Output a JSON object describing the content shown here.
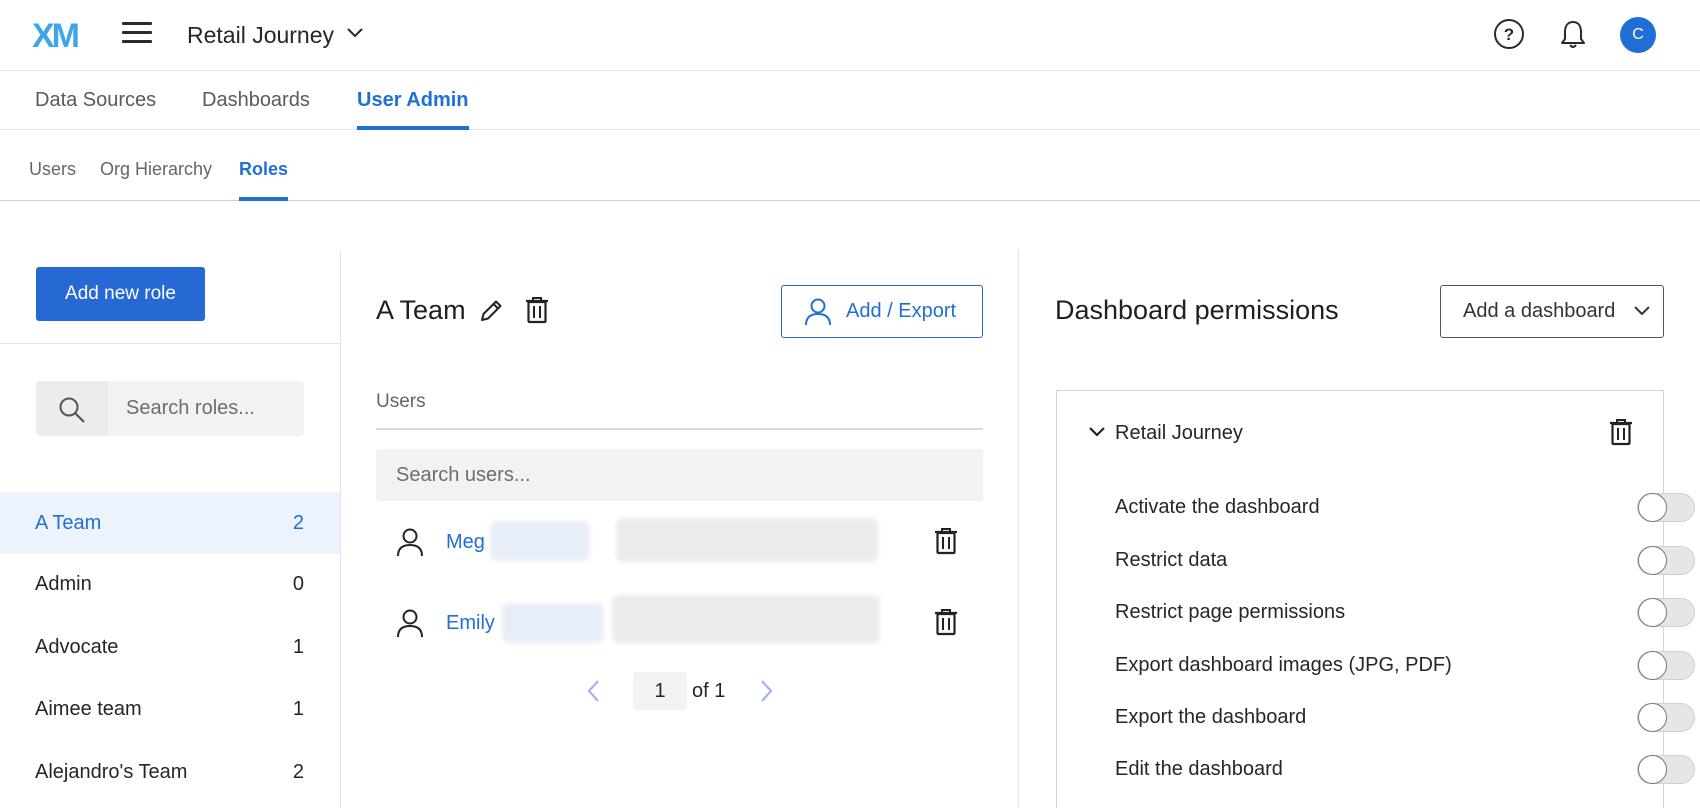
{
  "app": {
    "logo_text": "XM",
    "project_name": "Retail Journey",
    "avatar_initial": "C",
    "icons": [
      "hamburger-icon",
      "chevron-down-icon",
      "help-icon",
      "bell-icon"
    ]
  },
  "primary_tabs": [
    {
      "label": "Data Sources",
      "active": false
    },
    {
      "label": "Dashboards",
      "active": false
    },
    {
      "label": "User Admin",
      "active": true
    }
  ],
  "secondary_tabs": [
    {
      "label": "Users",
      "active": false
    },
    {
      "label": "Org Hierarchy",
      "active": false
    },
    {
      "label": "Roles",
      "active": true
    }
  ],
  "roles_panel": {
    "add_button_label": "Add new role",
    "search_placeholder": "Search roles...",
    "roles": [
      {
        "name": "A Team",
        "count": "2",
        "selected": true
      },
      {
        "name": "Admin",
        "count": "0",
        "selected": false
      },
      {
        "name": "Advocate",
        "count": "1",
        "selected": false
      },
      {
        "name": "Aimee team",
        "count": "1",
        "selected": false
      },
      {
        "name": "Alejandro's Team",
        "count": "2",
        "selected": false
      }
    ]
  },
  "role_detail": {
    "title": "A Team",
    "add_export_label": "Add / Export",
    "users_label": "Users",
    "search_placeholder": "Search users...",
    "users": [
      {
        "name": "Meg"
      },
      {
        "name": "Emily"
      }
    ],
    "pagination": {
      "current_page": "1",
      "of_label": "of 1"
    }
  },
  "dashboard_permissions": {
    "title": "Dashboard permissions",
    "add_dashboard_label": "Add a dashboard",
    "dashboard_name": "Retail Journey",
    "permissions": [
      {
        "label": "Activate the dashboard",
        "enabled": false
      },
      {
        "label": "Restrict data",
        "enabled": false
      },
      {
        "label": "Restrict page permissions",
        "enabled": false
      },
      {
        "label": "Export dashboard images (JPG, PDF)",
        "enabled": false
      },
      {
        "label": "Export the dashboard",
        "enabled": false
      },
      {
        "label": "Edit the dashboard",
        "enabled": false
      }
    ]
  },
  "colors": {
    "accent": "#1f6fd6",
    "primary_button": "#2769d4",
    "selected_row_bg": "#edf3fc"
  }
}
